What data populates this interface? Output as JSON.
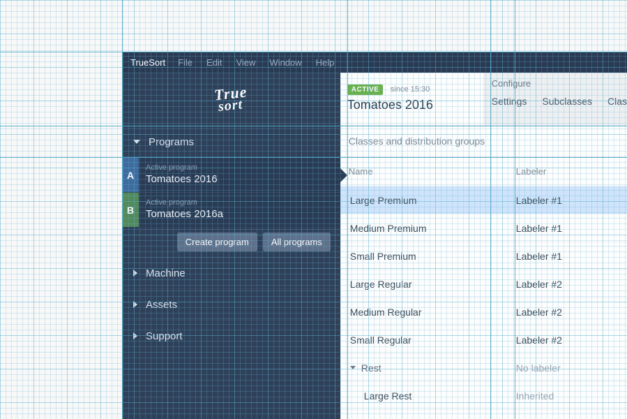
{
  "menubar": {
    "app": "TrueSort",
    "items": [
      "File",
      "Edit",
      "View",
      "Window",
      "Help"
    ]
  },
  "logo": {
    "line1": "True",
    "line2": "sort"
  },
  "sidebar": {
    "items": [
      "Programs",
      "Machine",
      "Assets",
      "Support"
    ],
    "expanded": "Programs"
  },
  "programs": {
    "sublabel": "Active program",
    "list": [
      {
        "badge": "A",
        "title": "Tomatoes 2016",
        "active": true
      },
      {
        "badge": "B",
        "title": "Tomatoes 2016a",
        "active": false
      }
    ],
    "buttons": {
      "create": "Create program",
      "all": "All programs"
    }
  },
  "header": {
    "status": "ACTIVE",
    "since": "since 15:30",
    "title": "Tomatoes 2016",
    "configure": "Configure",
    "tabs": [
      "Settings",
      "Subclasses",
      "Clas"
    ]
  },
  "section": {
    "title": "Classes and distribution groups"
  },
  "table": {
    "columns": {
      "name": "Name",
      "labeler": "Labeler"
    },
    "rows": [
      {
        "name": "Large Premium",
        "labeler": "Labeler #1",
        "selected": true
      },
      {
        "name": "Medium Premium",
        "labeler": "Labeler #1",
        "selected": false
      },
      {
        "name": "Small Premium",
        "labeler": "Labeler #1",
        "selected": false
      },
      {
        "name": "Large Regular",
        "labeler": "Labeler #2",
        "selected": false
      },
      {
        "name": "Medium Regular",
        "labeler": "Labeler #2",
        "selected": false
      },
      {
        "name": "Small Regular",
        "labeler": "Labeler #2",
        "selected": false
      }
    ],
    "rest": {
      "label": "Rest",
      "labeler": "No labeler"
    },
    "rest_sub": {
      "name": "Large Rest",
      "labeler": "Inherited"
    }
  }
}
